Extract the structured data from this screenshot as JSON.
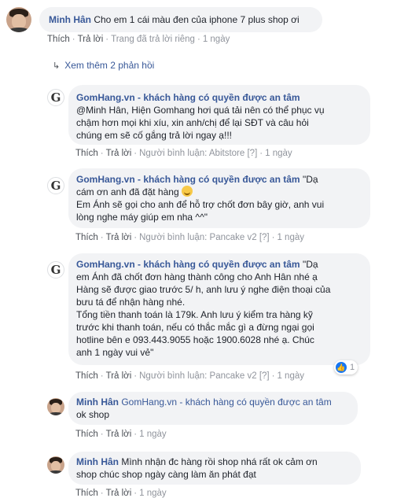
{
  "c1": {
    "name": "Minh Hân",
    "text": "Cho em 1 cái màu đen của iphone 7 plus shop ơi",
    "like": "Thích",
    "reply": "Trả lời",
    "meta": "Trang đã trả lời riêng",
    "time": "1 ngày"
  },
  "more": {
    "label": "Xem thêm 2 phản hồi"
  },
  "r1": {
    "name": "GomHang.vn - khách hàng có quyền được an tâm",
    "lines": [
      "@Minh Hân, Hiện Gomhang hơi quá tải nên có thể phục vụ",
      "chậm hơn mọi khi xíu, xin anh/chị để lại SĐT và câu hỏi",
      "chúng em sẽ cố gắng trả lời ngay ạ!!!"
    ],
    "like": "Thích",
    "reply": "Trả lời",
    "meta": "Người bình luận: Abitstore",
    "tag": "[?]",
    "time": "1 ngày"
  },
  "r2": {
    "name": "GomHang.vn - khách hàng có quyền được an tâm",
    "first": "\"Dạ",
    "line2": "cám ơn anh đã đặt hàng",
    "lines": [
      "Em Ánh sẽ gọi cho anh để hỗ trợ chốt đơn bây giờ, anh vui",
      "lòng nghe máy giúp em nha ^^\""
    ],
    "like": "Thích",
    "reply": "Trả lời",
    "meta": "Người bình luận: Pancake v2",
    "tag": "[?]",
    "time": "1 ngày"
  },
  "r3": {
    "name": "GomHang.vn - khách hàng có quyền được an tâm",
    "first": "\"Dạ",
    "lines": [
      "em Ánh đã chốt đơn hàng thành công cho Anh Hân nhé ạ",
      "Hàng sẽ được giao trước 5/ h, anh lưu ý nghe điện thoại của",
      "bưu tá để nhận hàng nhé.",
      "Tổng tiền thanh toán là 179k. Anh lưu ý kiểm tra hàng kỹ",
      "trước khi thanh toán, nếu có thắc mắc gì a đừng ngại gọi",
      "hotline bên e 093.443.9055 hoặc 1900.6028 nhé ạ. Chúc",
      "anh 1 ngày vui vẻ\""
    ],
    "reactions": "1",
    "like": "Thích",
    "reply": "Trả lời",
    "meta": "Người bình luận: Pancake v2",
    "tag": "[?]",
    "time": "1 ngày"
  },
  "r4": {
    "name": "Minh Hân",
    "mention": "GomHang.vn - khách hàng có quyền được an tâm",
    "text": "ok shop",
    "like": "Thích",
    "reply": "Trả lời",
    "time": "1 ngày"
  },
  "r5": {
    "name": "Minh Hân",
    "line1": "Mình nhận đc hàng rồi shop nhá rất ok cảm ơn",
    "line2": "shop chúc shop ngày càng làm ăn phát đạt",
    "like": "Thích",
    "reply": "Trả lời",
    "time": "1 ngày"
  },
  "page_avatar_letter": "G",
  "colors": {
    "name": "#385898",
    "bubble": "#f2f3f5",
    "meta": "#90949c",
    "like_blue": "#1877f2"
  }
}
